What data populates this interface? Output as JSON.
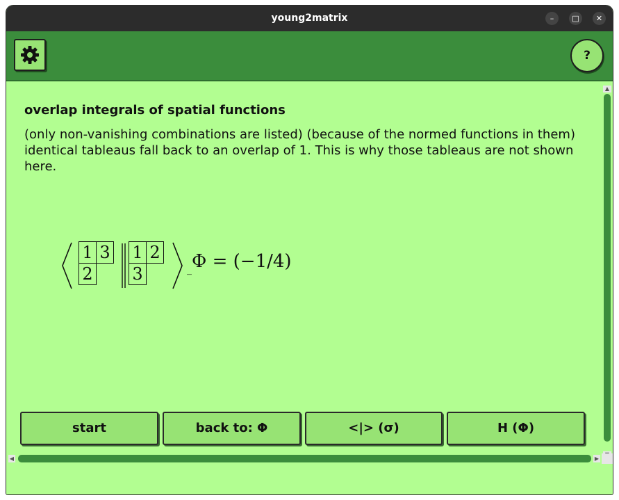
{
  "window": {
    "title": "young2matrix",
    "minimize_glyph": "–",
    "maximize_glyph": "□",
    "close_glyph": "✕"
  },
  "toolbar": {
    "settings_icon": "gear-icon",
    "help_label": "?"
  },
  "content": {
    "heading": "overlap integrals of spatial functions",
    "paragraph": "(only non-vanishing combinations are listed) (because of the normed functions in them) identical tableaus fall back to an overlap of 1. This is why those tableaus are not shown here.",
    "formula": {
      "left_tableau": {
        "row1": [
          "1",
          "3"
        ],
        "row2": [
          "2"
        ]
      },
      "right_tableau": {
        "row1": [
          "1",
          "2"
        ],
        "row2": [
          "3"
        ]
      },
      "subscript": "Φ",
      "result": "= (−1/4)"
    }
  },
  "buttons": {
    "start": "start",
    "back": "back to: Φ",
    "overlap": "<|> (σ)",
    "hamiltonian": "H (Φ)"
  },
  "colors": {
    "background": "#b2fe91",
    "toolbar": "#3b8d3c",
    "button": "#97e374",
    "titlebar": "#2c2c2c"
  }
}
